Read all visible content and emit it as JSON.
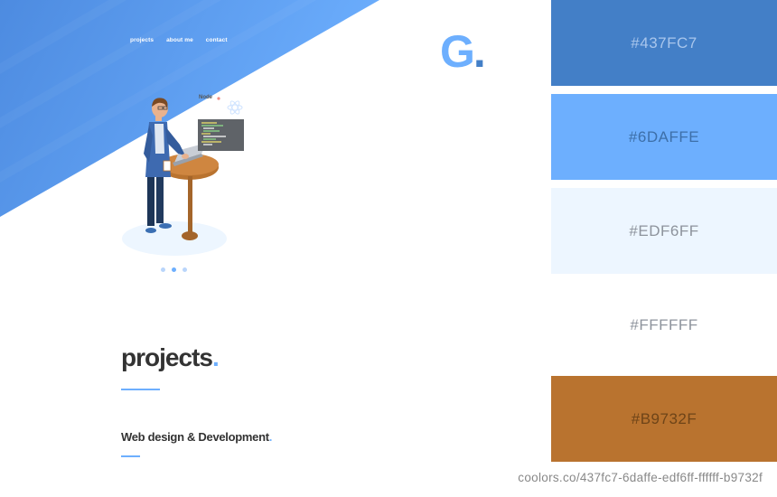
{
  "nav": {
    "items": [
      "projects",
      "about me",
      "contact"
    ]
  },
  "logo": {
    "letter": "G",
    "dot": "."
  },
  "illustration": {
    "bubble_text": "Node",
    "code_lines": 10
  },
  "carousel": {
    "active": 1,
    "count": 3
  },
  "projects": {
    "title": "projects",
    "dot": "."
  },
  "subtitle": {
    "text": "Web design & Development",
    "dot": "."
  },
  "palette": {
    "swatches": [
      {
        "hex": "#437FC7",
        "color": "#437fc7",
        "text_color": "#a9c6ec"
      },
      {
        "hex": "#6DAFFE",
        "color": "#6daffe",
        "text_color": "#3d6fa8"
      },
      {
        "hex": "#EDF6FF",
        "color": "#edf6ff",
        "text_color": "#8d939c"
      },
      {
        "hex": "#FFFFFF",
        "color": "#ffffff",
        "text_color": "#8d939c"
      },
      {
        "hex": "#B9732F",
        "color": "#b9732f",
        "text_color": "#6e4418"
      }
    ]
  },
  "source": {
    "text": "coolors.co/437fc7-6daffe-edf6ff-ffffff-b9732f"
  }
}
